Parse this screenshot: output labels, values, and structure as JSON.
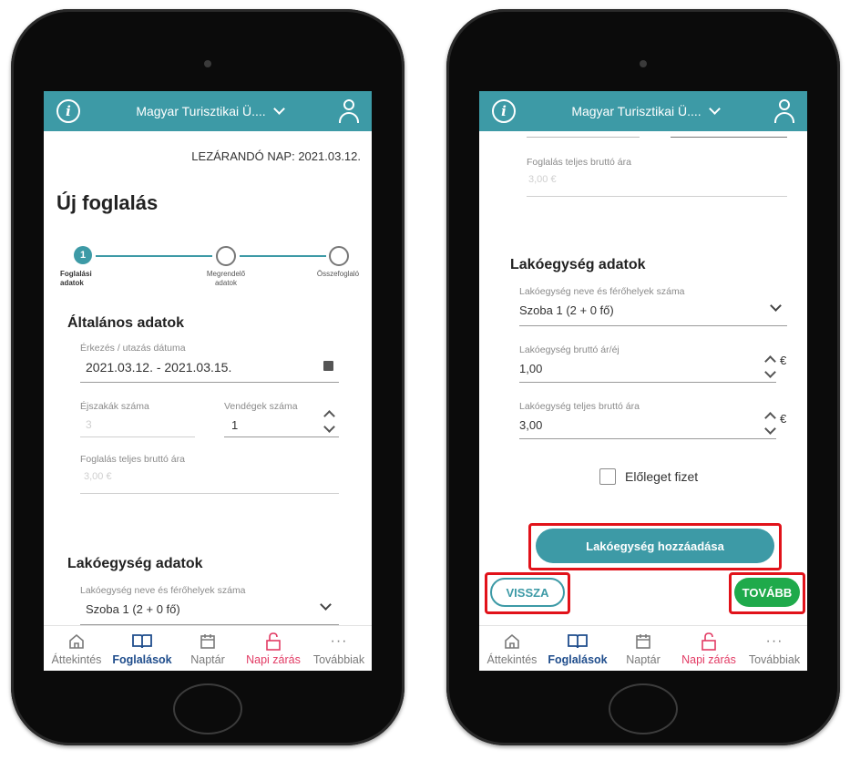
{
  "header": {
    "org_name": "Magyar Turisztikai Ü...."
  },
  "bottom_nav": {
    "items": [
      {
        "label": "Áttekintés",
        "icon": "home-icon"
      },
      {
        "label": "Foglalások",
        "icon": "book-icon"
      },
      {
        "label": "Naptár",
        "icon": "calendar-icon"
      },
      {
        "label": "Napi zárás",
        "icon": "unlock-icon"
      },
      {
        "label": "Továbbiak",
        "icon": "more-icon"
      }
    ]
  },
  "left_screen": {
    "closing_day": "LEZÁRANDÓ NAP: 2021.03.12.",
    "page_title": "Új foglalás",
    "steps": [
      {
        "number": "1",
        "label": "Foglalási adatok",
        "active": true
      },
      {
        "label": "Megrendelő adatok",
        "active": false
      },
      {
        "label": "Összefoglaló",
        "active": false
      }
    ],
    "general_section": "Általános adatok",
    "arrival_label": "Érkezés / utazás dátuma",
    "arrival_value": "2021.03.12. - 2021.03.15.",
    "nights_label": "Éjszakák száma",
    "nights_value": "3",
    "guests_label": "Vendégek száma",
    "guests_value": "1",
    "total_label": "Foglalás teljes bruttó ára",
    "total_value": "3,00 €",
    "unit_section": "Lakóegység adatok",
    "unit_name_label": "Lakóegység neve és férőhelyek száma",
    "unit_name_value": "Szoba 1 (2 + 0 fő)"
  },
  "right_screen": {
    "total_label": "Foglalás teljes bruttó ára",
    "total_value": "3,00 €",
    "unit_section": "Lakóegység adatok",
    "unit_name_label": "Lakóegység neve és férőhelyek száma",
    "unit_name_value": "Szoba 1 (2 + 0 fő)",
    "unit_price_label": "Lakóegység bruttó ár/éj",
    "unit_price_value": "1,00",
    "unit_total_label": "Lakóegység teljes bruttó ára",
    "unit_total_value": "3,00",
    "currency": "€",
    "deposit_label": "Előleget fizet",
    "add_unit_button": "Lakóegység hozzáadása",
    "back_button": "VISSZA",
    "next_button": "TOVÁBB"
  },
  "colors": {
    "brand_teal": "#3d9aa6",
    "next_green": "#1faa4b",
    "active_nav": "#1f4d8c",
    "alert_nav": "#e23b64",
    "highlight_red": "#e1121a"
  }
}
